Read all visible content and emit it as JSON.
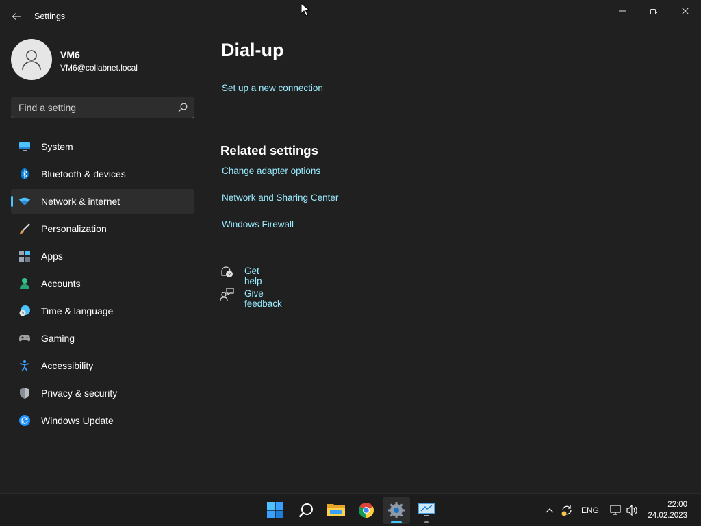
{
  "window": {
    "title": "Settings"
  },
  "profile": {
    "name": "VM6",
    "email": "VM6@collabnet.local"
  },
  "search": {
    "placeholder": "Find a setting"
  },
  "sidebar": {
    "items": [
      {
        "label": "System",
        "icon": "monitor-icon",
        "color": "#4cc2ff"
      },
      {
        "label": "Bluetooth & devices",
        "icon": "bluetooth-icon",
        "color": "#0078d4"
      },
      {
        "label": "Network & internet",
        "icon": "wifi-icon",
        "color": "#4cc2ff",
        "active": true
      },
      {
        "label": "Personalization",
        "icon": "brush-icon",
        "color": "#e8a25a"
      },
      {
        "label": "Apps",
        "icon": "apps-icon",
        "color": "#9aa6b5"
      },
      {
        "label": "Accounts",
        "icon": "person-icon",
        "color": "#31c48d"
      },
      {
        "label": "Time & language",
        "icon": "globe-clock-icon",
        "color": "#4cc2ff"
      },
      {
        "label": "Gaming",
        "icon": "gamepad-icon",
        "color": "#a0a0a0"
      },
      {
        "label": "Accessibility",
        "icon": "accessibility-icon",
        "color": "#3aa0ff"
      },
      {
        "label": "Privacy & security",
        "icon": "shield-icon",
        "color": "#8a8f96"
      },
      {
        "label": "Windows Update",
        "icon": "update-icon",
        "color": "#1e90ff"
      }
    ]
  },
  "main": {
    "title": "Dial-up",
    "setup_link": "Set up a new connection",
    "related_title": "Related settings",
    "related_links": [
      "Change adapter options",
      "Network and Sharing Center",
      "Windows Firewall"
    ],
    "get_help": "Get help",
    "give_feedback": "Give feedback"
  },
  "taskbar": {
    "apps": [
      "start-icon",
      "search-icon",
      "file-explorer-icon",
      "chrome-icon",
      "settings-icon",
      "remote-desktop-icon"
    ],
    "language": "ENG",
    "time": "22:00",
    "date": "24.02.2023"
  },
  "colors": {
    "accent": "#4cc2ff",
    "link": "#99ebff",
    "background": "#202020",
    "taskbar": "#1c1c1c"
  }
}
